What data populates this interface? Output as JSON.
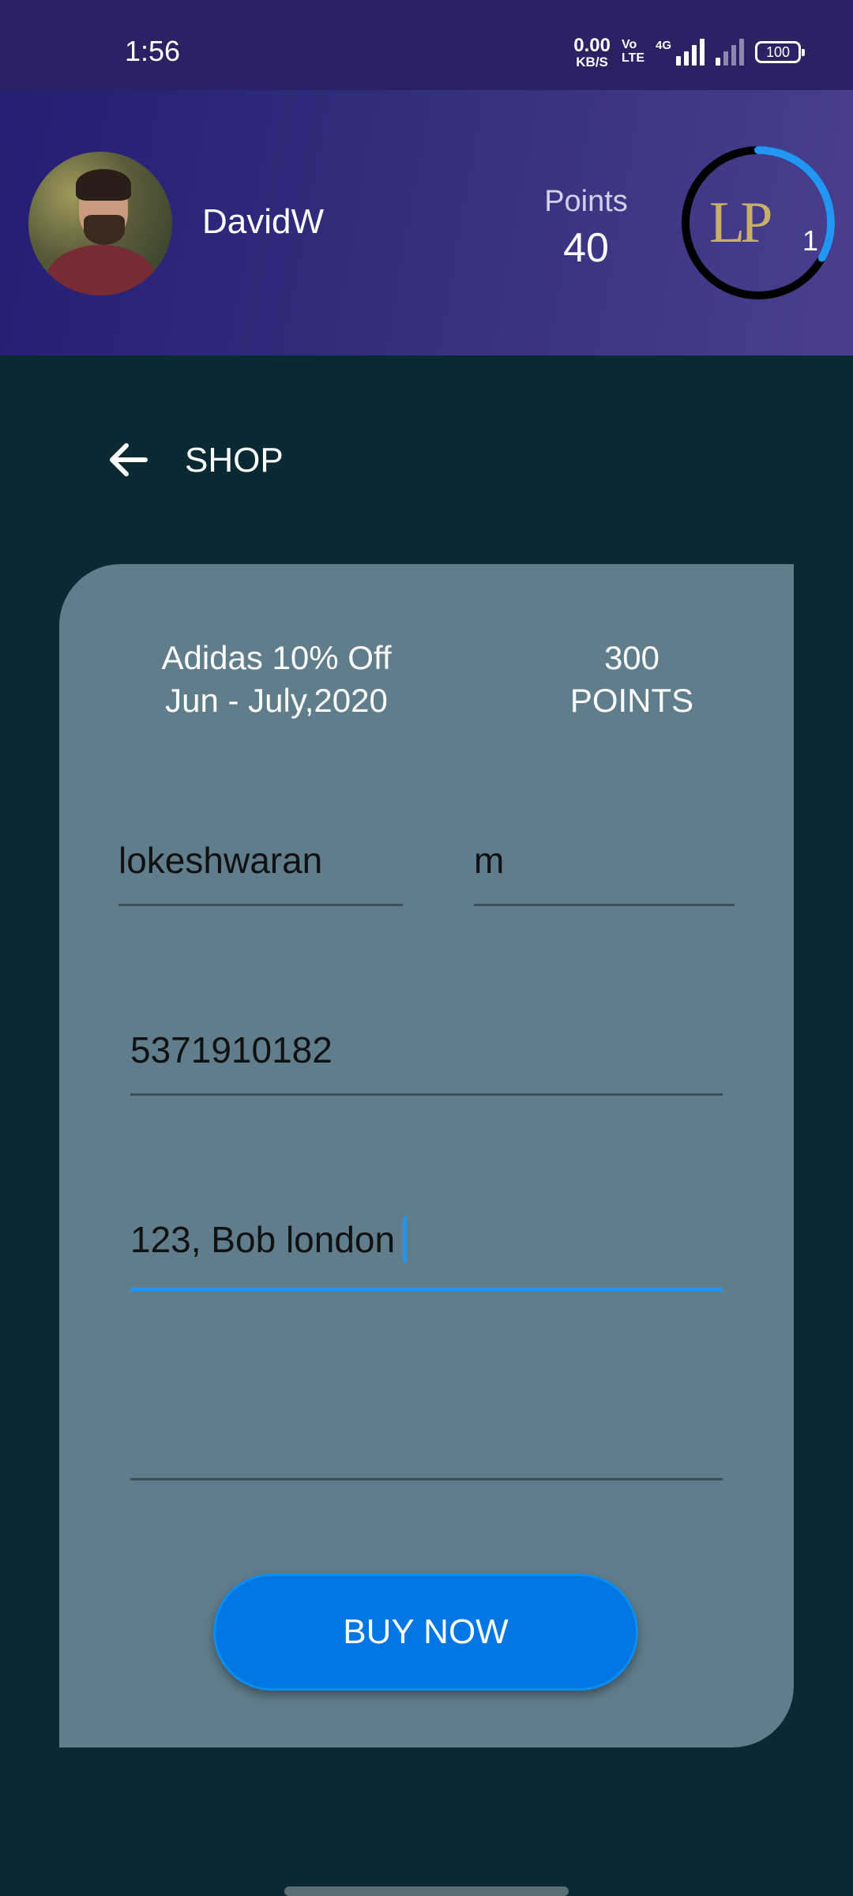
{
  "status_bar": {
    "time": "1:56",
    "net_speed_value": "0.00",
    "net_speed_unit": "KB/S",
    "volte_top": "Vo",
    "volte_bottom": "LTE",
    "network_type": "4G",
    "battery": "100",
    "icons": [
      "volte-icon",
      "signal-icon",
      "signal-icon-dim",
      "battery-icon"
    ]
  },
  "header": {
    "username": "DavidW",
    "points_label": "Points",
    "points_value": "40",
    "level_logo": "LP",
    "level_number": "1",
    "level_progress": 0.33,
    "colors": {
      "ring_track": "#000000",
      "ring_progress": "#2196f3"
    }
  },
  "nav": {
    "back_icon": "arrow-left-icon",
    "title": "SHOP"
  },
  "offer": {
    "title": "Adidas 10% Off",
    "dates": "Jun - July,2020",
    "points": "300",
    "points_unit": "POINTS"
  },
  "form": {
    "first_name": "lokeshwaran",
    "gender": "m",
    "phone": "5371910182",
    "address": "123, Bob london",
    "extra": ""
  },
  "actions": {
    "buy_label": "BUY NOW"
  },
  "colors": {
    "background": "#0a2a33",
    "card": "#607d8b",
    "accent": "#0277e3",
    "focus_underline": "#2196f3"
  }
}
